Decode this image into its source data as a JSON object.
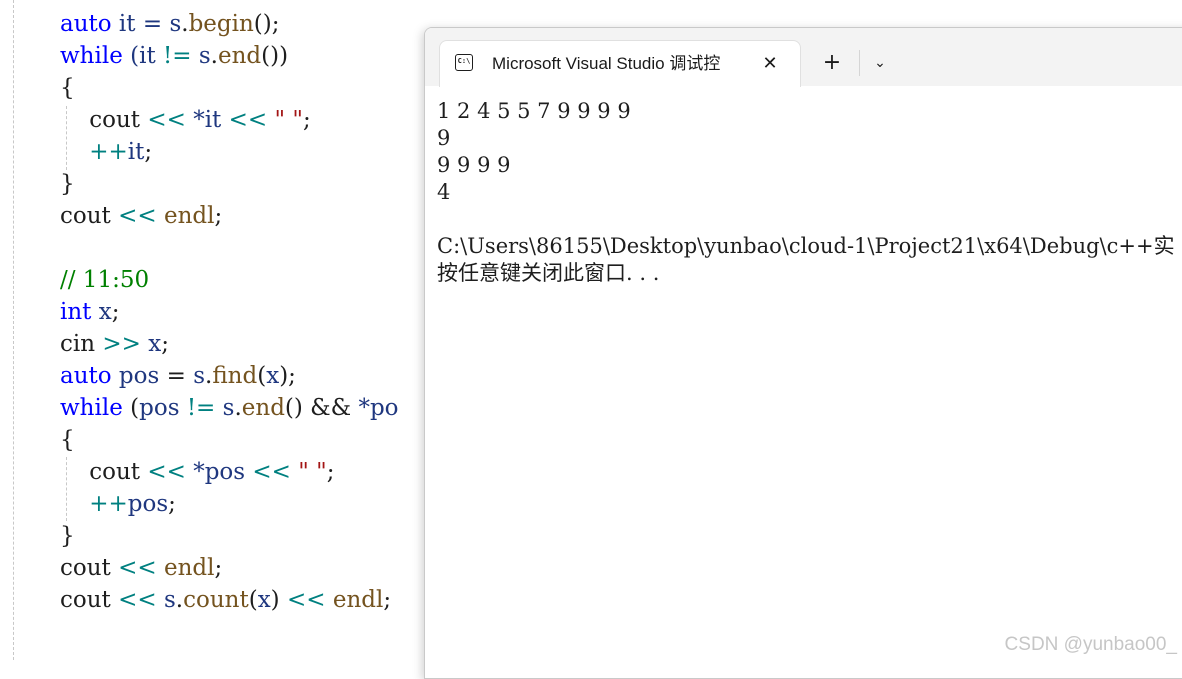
{
  "editor": {
    "lines": [
      {
        "tokens": [
          {
            "t": "auto",
            "c": "kw"
          },
          {
            "t": " it = ",
            "c": "id"
          },
          {
            "t": "s",
            "c": "id"
          },
          {
            "t": ".",
            "c": "pl"
          },
          {
            "t": "begin",
            "c": "fn"
          },
          {
            "t": "();",
            "c": "pl"
          }
        ]
      },
      {
        "tokens": [
          {
            "t": "while",
            "c": "kw"
          },
          {
            "t": " (it ",
            "c": "id"
          },
          {
            "t": "!=",
            "c": "op"
          },
          {
            "t": " s",
            "c": "id"
          },
          {
            "t": ".",
            "c": "pl"
          },
          {
            "t": "end",
            "c": "fn"
          },
          {
            "t": "())",
            "c": "pl"
          }
        ]
      },
      {
        "tokens": [
          {
            "t": "{",
            "c": "pl"
          }
        ]
      },
      {
        "tokens": [
          {
            "t": "    cout ",
            "c": "pl"
          },
          {
            "t": "<<",
            "c": "op"
          },
          {
            "t": " ",
            "c": "pl"
          },
          {
            "t": "*it",
            "c": "id"
          },
          {
            "t": " ",
            "c": "pl"
          },
          {
            "t": "<<",
            "c": "op"
          },
          {
            "t": " ",
            "c": "pl"
          },
          {
            "t": "\" \"",
            "c": "str"
          },
          {
            "t": ";",
            "c": "pl"
          }
        ]
      },
      {
        "tokens": [
          {
            "t": "    ",
            "c": "pl"
          },
          {
            "t": "++",
            "c": "op"
          },
          {
            "t": "it",
            "c": "id"
          },
          {
            "t": ";",
            "c": "pl"
          }
        ]
      },
      {
        "tokens": [
          {
            "t": "}",
            "c": "pl"
          }
        ]
      },
      {
        "tokens": [
          {
            "t": "cout ",
            "c": "pl"
          },
          {
            "t": "<<",
            "c": "op"
          },
          {
            "t": " endl",
            "c": "fn"
          },
          {
            "t": ";",
            "c": "pl"
          }
        ]
      },
      {
        "tokens": []
      },
      {
        "tokens": [
          {
            "t": "// 11:50",
            "c": "cm"
          }
        ]
      },
      {
        "tokens": [
          {
            "t": "int",
            "c": "kw"
          },
          {
            "t": " x",
            "c": "id"
          },
          {
            "t": ";",
            "c": "pl"
          }
        ]
      },
      {
        "tokens": [
          {
            "t": "cin ",
            "c": "pl"
          },
          {
            "t": ">>",
            "c": "op"
          },
          {
            "t": " x",
            "c": "id"
          },
          {
            "t": ";",
            "c": "pl"
          }
        ]
      },
      {
        "tokens": [
          {
            "t": "auto",
            "c": "kw"
          },
          {
            "t": " pos",
            "c": "id"
          },
          {
            "t": " = ",
            "c": "pl"
          },
          {
            "t": "s",
            "c": "id"
          },
          {
            "t": ".",
            "c": "pl"
          },
          {
            "t": "find",
            "c": "fn"
          },
          {
            "t": "(",
            "c": "pl"
          },
          {
            "t": "x",
            "c": "id"
          },
          {
            "t": ");",
            "c": "pl"
          }
        ]
      },
      {
        "tokens": [
          {
            "t": "while",
            "c": "kw"
          },
          {
            "t": " (",
            "c": "pl"
          },
          {
            "t": "pos",
            "c": "id"
          },
          {
            "t": " ",
            "c": "pl"
          },
          {
            "t": "!=",
            "c": "op"
          },
          {
            "t": " s",
            "c": "id"
          },
          {
            "t": ".",
            "c": "pl"
          },
          {
            "t": "end",
            "c": "fn"
          },
          {
            "t": "() && ",
            "c": "pl"
          },
          {
            "t": "*po",
            "c": "id"
          }
        ]
      },
      {
        "tokens": [
          {
            "t": "{",
            "c": "pl"
          }
        ]
      },
      {
        "tokens": [
          {
            "t": "    cout ",
            "c": "pl"
          },
          {
            "t": "<<",
            "c": "op"
          },
          {
            "t": " ",
            "c": "pl"
          },
          {
            "t": "*pos",
            "c": "id"
          },
          {
            "t": " ",
            "c": "pl"
          },
          {
            "t": "<<",
            "c": "op"
          },
          {
            "t": " ",
            "c": "pl"
          },
          {
            "t": "\" \"",
            "c": "str"
          },
          {
            "t": ";",
            "c": "pl"
          }
        ]
      },
      {
        "tokens": [
          {
            "t": "    ",
            "c": "pl"
          },
          {
            "t": "++",
            "c": "op"
          },
          {
            "t": "pos",
            "c": "id"
          },
          {
            "t": ";",
            "c": "pl"
          }
        ]
      },
      {
        "tokens": [
          {
            "t": "}",
            "c": "pl"
          }
        ]
      },
      {
        "tokens": [
          {
            "t": "cout ",
            "c": "pl"
          },
          {
            "t": "<<",
            "c": "op"
          },
          {
            "t": " endl",
            "c": "fn"
          },
          {
            "t": ";",
            "c": "pl"
          }
        ]
      },
      {
        "tokens": [
          {
            "t": "cout ",
            "c": "pl"
          },
          {
            "t": "<<",
            "c": "op"
          },
          {
            "t": " s",
            "c": "id"
          },
          {
            "t": ".",
            "c": "pl"
          },
          {
            "t": "count",
            "c": "fn"
          },
          {
            "t": "(",
            "c": "pl"
          },
          {
            "t": "x",
            "c": "id"
          },
          {
            "t": ") ",
            "c": "pl"
          },
          {
            "t": "<<",
            "c": "op"
          },
          {
            "t": " endl",
            "c": "fn"
          },
          {
            "t": ";",
            "c": "pl"
          }
        ]
      }
    ]
  },
  "terminal": {
    "tab": {
      "icon": "terminal-icon",
      "icon_text": "C:\\",
      "title": "Microsoft Visual Studio 调试控",
      "close_glyph": "✕"
    },
    "new_tab_glyph": "+",
    "dropdown_glyph": "⌄",
    "output": [
      "1 2 4 5 5 7 9 9 9 9",
      "9",
      "9 9 9 9",
      "4",
      "",
      "C:\\Users\\86155\\Desktop\\yunbao\\cloud-1\\Project21\\x64\\Debug\\c++实",
      "按任意键关闭此窗口. . ."
    ]
  },
  "watermark": "CSDN @yunbao00_",
  "colors": {
    "keyword": "#0000ff",
    "identifier": "#1f377f",
    "function": "#74531f",
    "operator": "#008080",
    "string": "#a31515",
    "comment": "#008000"
  }
}
